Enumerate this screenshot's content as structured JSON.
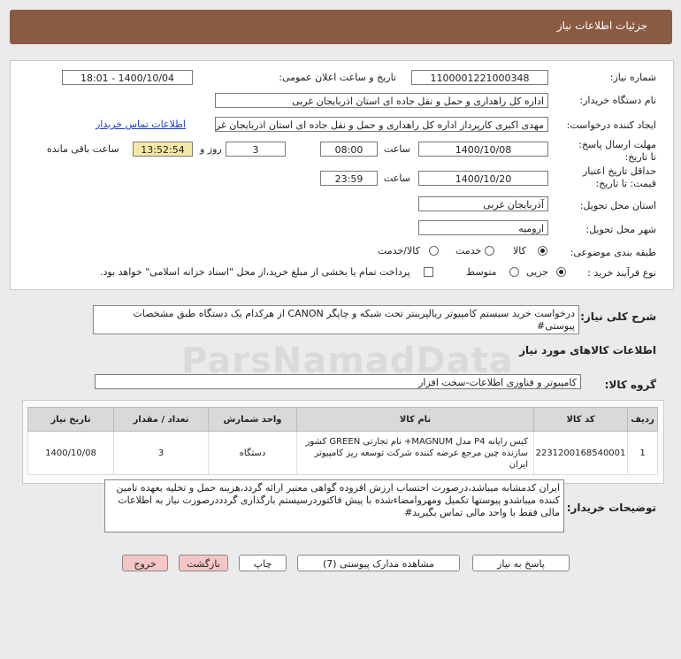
{
  "header": {
    "title": "جزئیات اطلاعات نیاز"
  },
  "form": {
    "need_number_label": "شماره نیاز:",
    "need_number": "1100001221000348",
    "announce_label": "تاریخ و ساعت اعلان عمومی:",
    "announce_value": "1400/10/04 - 18:01",
    "buyer_org_label": "نام دستگاه خریدار:",
    "buyer_org": "اداره کل راهداری و حمل و نقل جاده ای استان اذربایجان غربی",
    "creator_label": "ایجاد کننده درخواست:",
    "creator": "مهدی اکبری کارپرداز اداره کل راهداری و حمل و نقل جاده ای استان اذربایجان غربی",
    "contact_link": "اطلاعات تماس خریدار",
    "deadline_label": "مهلت ارسال پاسخ: تا تاریخ:",
    "deadline_date": "1400/10/08",
    "time_label": "ساعت",
    "deadline_time": "08:00",
    "days": "3",
    "days_label": "روز و",
    "remaining_time": "13:52:54",
    "remaining_label": "ساعت باقی مانده",
    "validity_label": "حداقل تاریخ اعتبار قیمت: تا تاریخ:",
    "validity_date": "1400/10/20",
    "validity_time": "23:59",
    "province_label": "استان محل تحویل:",
    "province": "آذربایجان غربی",
    "city_label": "شهر محل تحویل:",
    "city": "ارومیه",
    "category_label": "طبقه بندی موضوعی:",
    "category_options": [
      "کالا",
      "خدمت",
      "کالا/خدمت"
    ],
    "category_selected": "کالا",
    "purchase_label": "نوع فرآیند خرید :",
    "purchase_options": [
      "جزیی",
      "متوسط"
    ],
    "purchase_selected": "جزیی",
    "payment_note": "پرداخت تمام یا بخشی از مبلغ خرید،از محل \"اسناد خزانه اسلامی\" خواهد بود."
  },
  "description": {
    "label": "شرح کلی نیاز:",
    "text": "درخواست خرید سیستم کامپیوتر ریالپرینتر تحت شبکه و چاپگر CANON از هرکدام یک دستگاه طبق مشخصات پیوستی#"
  },
  "goods": {
    "section_label": "اطلاعات کالاهای مورد نیاز",
    "group_label": "گروه کالا:",
    "group_value": "کامپیوتر و فناوری اطلاعات-سخت افزار",
    "columns": [
      "ردیف",
      "کد کالا",
      "نام کالا",
      "واحد شمارش",
      "تعداد / مقدار",
      "تاریخ نیاز"
    ],
    "rows": [
      {
        "index": "1",
        "code": "2231200168540001",
        "name": "کیس رایانه P4 مدل MAGNUM+ نام تجارتی GREEN کشور سازنده چین مرجع عرضه کننده شرکت توسعه ریز کامپیوتر ایران",
        "unit": "دستگاه",
        "qty": "3",
        "date": "1400/10/08"
      }
    ]
  },
  "buyer_notes": {
    "label": "توضیحات خریدار:",
    "text": "ایران کدمشابه میباشد،درصورت احتساب ارزش افزوده گواهی معتبر ارائه گردد،هزینه حمل و تخلیه بعهده تامین کننده میباشدو پیوستها تکمیل ومهروامضاءشده با پیش فاکتوردرسیستم بارگذاری گردددرصورت نیاز به اطلاعات مالی فقط با واحد مالی تماس بگیرید#"
  },
  "buttons": {
    "reply": "پاسخ به نیاز",
    "attachments": "مشاهده مدارک پیوستی (7)",
    "print": "چاپ",
    "back": "بازگشت",
    "exit": "خروج"
  },
  "watermark": {
    "text": "ParsNamadData"
  }
}
